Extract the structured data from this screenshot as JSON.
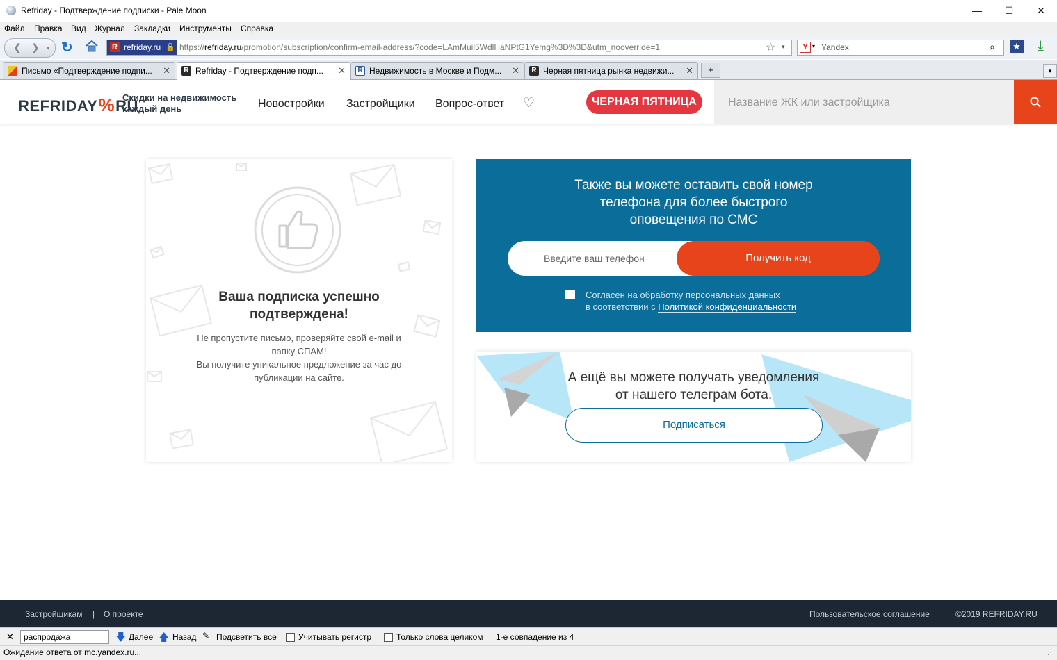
{
  "window": {
    "title": "Refriday - Подтверждение подписки - Pale Moon",
    "minimize": "—",
    "maximize": "☐",
    "close": "✕"
  },
  "menu": [
    "Файл",
    "Правка",
    "Вид",
    "Журнал",
    "Закладки",
    "Инструменты",
    "Справка"
  ],
  "navbar": {
    "identity": "refriday.ru",
    "url_prefix": "https://",
    "url_host": "refriday.ru",
    "url_path": "/promotion/subscription/confirm-email-address/?code=LAmMuil5WdlHaNPtG1Yemg%3D%3D&utm_nooverride=1",
    "search_engine_value": "Yandex"
  },
  "tabs": [
    {
      "label": "Письмо «Подтверждение подпи...",
      "active": false
    },
    {
      "label": "Refriday - Подтверждение подп...",
      "active": true
    },
    {
      "label": "Недвижимость в Москве и Подм...",
      "active": false
    },
    {
      "label": "Черная пятница рынка недвижи...",
      "active": false
    }
  ],
  "site": {
    "logo_main": "REFRIDAY",
    "logo_ru": "RU",
    "tagline_line1": "Скидки на недвижимость",
    "tagline_line2": "каждый день",
    "nav": [
      "Новостройки",
      "Застройщики",
      "Вопрос-ответ"
    ],
    "promo": "ЧЕРНАЯ ПЯТНИЦА",
    "search_placeholder": "Название ЖК или застройщика"
  },
  "confirm_card": {
    "heading_line1": "Ваша подписка успешно",
    "heading_line2": "подтверждена!",
    "text_line1": "Не пропустите письмо, проверяйте свой e-mail и",
    "text_line2": "папку СПАМ!",
    "text_line3": "Вы получите уникальное предложение за час до",
    "text_line4": "публикации на сайте."
  },
  "sms_card": {
    "heading_line1": "Также вы можете оставить свой номер",
    "heading_line2": "телефона для более быстрого",
    "heading_line3": "оповещения по СМС",
    "phone_placeholder": "Введите ваш телефон",
    "submit": "Получить код",
    "consent_line1": "Согласен на обработку персональных данных",
    "consent_line2_prefix": "в соответствии с ",
    "consent_link": "Политикой конфиденциальности"
  },
  "telegram_card": {
    "heading_line1": "А ещё вы можете получать уведомления",
    "heading_line2": "от нашего телеграм бота.",
    "button": "Подписаться"
  },
  "footer": {
    "link_developers": "Застройщикам",
    "separator": "|",
    "link_about": "О проекте",
    "link_terms": "Пользовательское соглашение",
    "copyright": "©2019 REFRIDAY.RU"
  },
  "findbar": {
    "query": "распродажа",
    "next": "Далее",
    "prev": "Назад",
    "highlight": "Подсветить все",
    "match_case": "Учитывать регистр",
    "whole_words": "Только слова целиком",
    "result": "1-е совпадение из 4"
  },
  "status": "Ожидание ответа от mc.yandex.ru...",
  "colors": {
    "accent_orange": "#e7441c",
    "promo_red": "#e5373f",
    "sms_card_blue": "#0b6d99",
    "footer_dark": "#1c2733"
  }
}
